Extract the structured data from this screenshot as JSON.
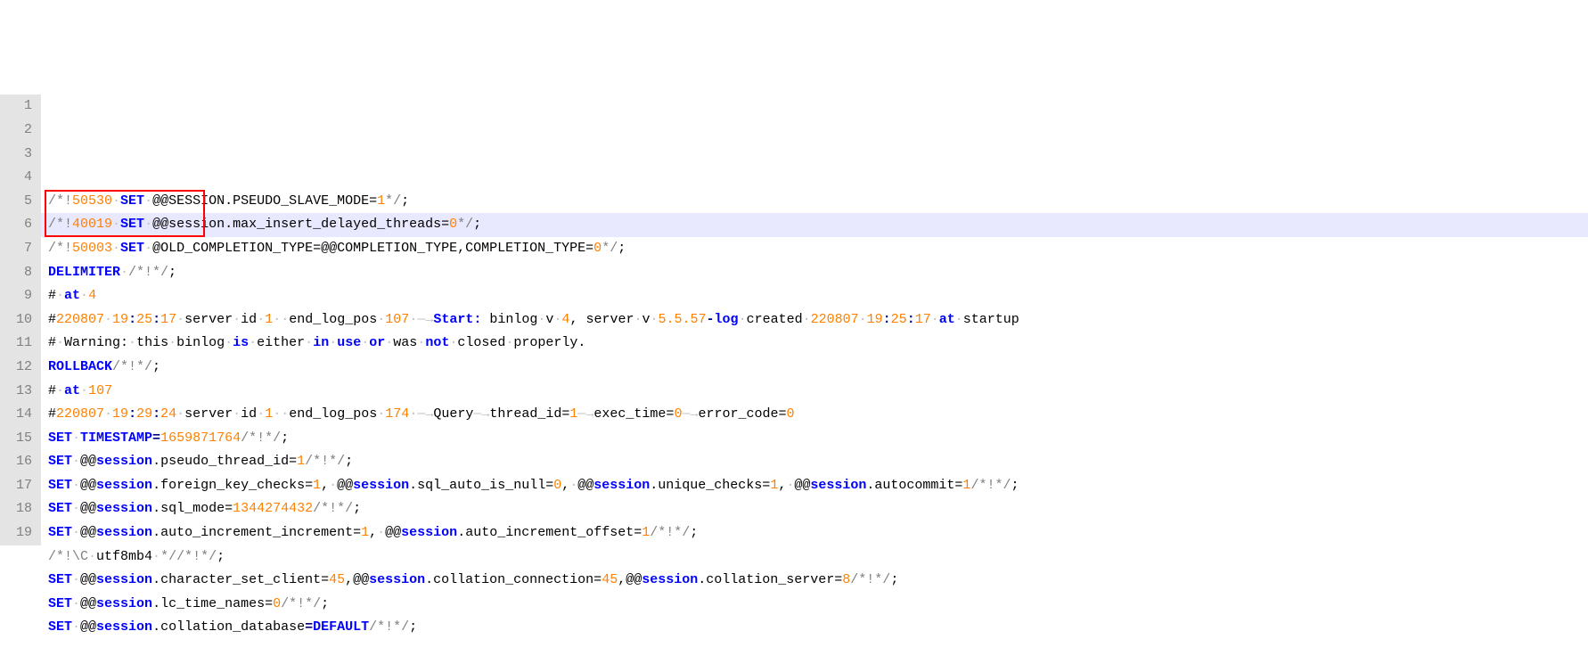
{
  "gutter": [
    "1",
    "2",
    "3",
    "4",
    "5",
    "6",
    "7",
    "8",
    "9",
    "10",
    "11",
    "12",
    "13",
    "14",
    "15",
    "16",
    "17",
    "18",
    "19"
  ],
  "highlight_row_index": 5,
  "red_box": {
    "top_line": 4,
    "left_ch": 0,
    "width_ch": 20,
    "height_lines": 2
  },
  "lines": [
    [
      {
        "t": "/*!",
        "c": "tk-str"
      },
      {
        "t": "50530",
        "c": "tk-num"
      },
      {
        "t": "·",
        "c": "ws-dot"
      },
      {
        "t": "SET",
        "c": "tk-kw"
      },
      {
        "t": "·",
        "c": "ws-dot"
      },
      {
        "t": "@@SESSION.PSEUDO_SLAVE_MODE=",
        "c": "tk-def"
      },
      {
        "t": "1",
        "c": "tk-num"
      },
      {
        "t": "*/",
        "c": "tk-str"
      },
      {
        "t": ";",
        "c": "tk-def"
      }
    ],
    [
      {
        "t": "/*!",
        "c": "tk-str"
      },
      {
        "t": "40019",
        "c": "tk-num"
      },
      {
        "t": "·",
        "c": "ws-dot"
      },
      {
        "t": "SET",
        "c": "tk-kw"
      },
      {
        "t": "·",
        "c": "ws-dot"
      },
      {
        "t": "@@session.max_insert_delayed_threads=",
        "c": "tk-def"
      },
      {
        "t": "0",
        "c": "tk-num"
      },
      {
        "t": "*/",
        "c": "tk-str"
      },
      {
        "t": ";",
        "c": "tk-def"
      }
    ],
    [
      {
        "t": "/*!",
        "c": "tk-str"
      },
      {
        "t": "50003",
        "c": "tk-num"
      },
      {
        "t": "·",
        "c": "ws-dot"
      },
      {
        "t": "SET",
        "c": "tk-kw"
      },
      {
        "t": "·",
        "c": "ws-dot"
      },
      {
        "t": "@OLD_COMPLETION_TYPE=@@COMPLETION_TYPE,COMPLETION_TYPE=",
        "c": "tk-def"
      },
      {
        "t": "0",
        "c": "tk-num"
      },
      {
        "t": "*/",
        "c": "tk-str"
      },
      {
        "t": ";",
        "c": "tk-def"
      }
    ],
    [
      {
        "t": "DELIMITER",
        "c": "tk-kw"
      },
      {
        "t": "·",
        "c": "ws-dot"
      },
      {
        "t": "/*!*/",
        "c": "tk-str"
      },
      {
        "t": ";",
        "c": "tk-def"
      }
    ],
    [
      {
        "t": "#",
        "c": "tk-def"
      },
      {
        "t": "·",
        "c": "ws-dot"
      },
      {
        "t": "at",
        "c": "tk-kw"
      },
      {
        "t": "·",
        "c": "ws-dot"
      },
      {
        "t": "4",
        "c": "tk-num"
      }
    ],
    [
      {
        "t": "#",
        "c": "tk-def"
      },
      {
        "t": "220807",
        "c": "tk-num"
      },
      {
        "t": "·",
        "c": "ws-dot"
      },
      {
        "t": "19",
        "c": "tk-num"
      },
      {
        "t": ":",
        "c": "tk-op"
      },
      {
        "t": "25",
        "c": "tk-num"
      },
      {
        "t": ":",
        "c": "tk-op"
      },
      {
        "t": "17",
        "c": "tk-num"
      },
      {
        "t": "·",
        "c": "ws-dot"
      },
      {
        "t": "server",
        "c": "tk-def"
      },
      {
        "t": "·",
        "c": "ws-dot"
      },
      {
        "t": "id",
        "c": "tk-def"
      },
      {
        "t": "·",
        "c": "ws-dot"
      },
      {
        "t": "1",
        "c": "tk-num"
      },
      {
        "t": "·",
        "c": "ws-dot"
      },
      {
        "t": "·",
        "c": "ws-dot"
      },
      {
        "t": "end_log_pos",
        "c": "tk-def"
      },
      {
        "t": "·",
        "c": "ws-dot"
      },
      {
        "t": "107",
        "c": "tk-num"
      },
      {
        "t": "·",
        "c": "ws-dot"
      },
      {
        "t": "→",
        "c": "ws-arr"
      },
      {
        "t": "Start:",
        "c": "tk-kw"
      },
      {
        "t": " binlog",
        "c": "tk-def"
      },
      {
        "t": "·",
        "c": "ws-dot"
      },
      {
        "t": "v",
        "c": "tk-def"
      },
      {
        "t": "·",
        "c": "ws-dot"
      },
      {
        "t": "4",
        "c": "tk-num"
      },
      {
        "t": ",",
        "c": "tk-def"
      },
      {
        "t": " server",
        "c": "tk-def"
      },
      {
        "t": "·",
        "c": "ws-dot"
      },
      {
        "t": "v",
        "c": "tk-def"
      },
      {
        "t": "·",
        "c": "ws-dot"
      },
      {
        "t": "5.5.57",
        "c": "tk-num"
      },
      {
        "t": "-",
        "c": "tk-op"
      },
      {
        "t": "log",
        "c": "tk-kw"
      },
      {
        "t": "·",
        "c": "ws-dot"
      },
      {
        "t": "created",
        "c": "tk-def"
      },
      {
        "t": "·",
        "c": "ws-dot"
      },
      {
        "t": "220807",
        "c": "tk-num"
      },
      {
        "t": "·",
        "c": "ws-dot"
      },
      {
        "t": "19",
        "c": "tk-num"
      },
      {
        "t": ":",
        "c": "tk-op"
      },
      {
        "t": "25",
        "c": "tk-num"
      },
      {
        "t": ":",
        "c": "tk-op"
      },
      {
        "t": "17",
        "c": "tk-num"
      },
      {
        "t": "·",
        "c": "ws-dot"
      },
      {
        "t": "at",
        "c": "tk-kw"
      },
      {
        "t": "·",
        "c": "ws-dot"
      },
      {
        "t": "startup",
        "c": "tk-def"
      }
    ],
    [
      {
        "t": "#",
        "c": "tk-def"
      },
      {
        "t": "·",
        "c": "ws-dot"
      },
      {
        "t": "Warning:",
        "c": "tk-def"
      },
      {
        "t": "·",
        "c": "ws-dot"
      },
      {
        "t": "this",
        "c": "tk-def"
      },
      {
        "t": "·",
        "c": "ws-dot"
      },
      {
        "t": "binlog",
        "c": "tk-def"
      },
      {
        "t": "·",
        "c": "ws-dot"
      },
      {
        "t": "is",
        "c": "tk-kw"
      },
      {
        "t": "·",
        "c": "ws-dot"
      },
      {
        "t": "either",
        "c": "tk-def"
      },
      {
        "t": "·",
        "c": "ws-dot"
      },
      {
        "t": "in",
        "c": "tk-kw"
      },
      {
        "t": "·",
        "c": "ws-dot"
      },
      {
        "t": "use",
        "c": "tk-kw"
      },
      {
        "t": "·",
        "c": "ws-dot"
      },
      {
        "t": "or",
        "c": "tk-kw"
      },
      {
        "t": "·",
        "c": "ws-dot"
      },
      {
        "t": "was",
        "c": "tk-def"
      },
      {
        "t": "·",
        "c": "ws-dot"
      },
      {
        "t": "not",
        "c": "tk-kw"
      },
      {
        "t": "·",
        "c": "ws-dot"
      },
      {
        "t": "closed",
        "c": "tk-def"
      },
      {
        "t": "·",
        "c": "ws-dot"
      },
      {
        "t": "properly.",
        "c": "tk-def"
      }
    ],
    [
      {
        "t": "ROLLBACK",
        "c": "tk-kw"
      },
      {
        "t": "/*!*/",
        "c": "tk-str"
      },
      {
        "t": ";",
        "c": "tk-def"
      }
    ],
    [
      {
        "t": "#",
        "c": "tk-def"
      },
      {
        "t": "·",
        "c": "ws-dot"
      },
      {
        "t": "at",
        "c": "tk-kw"
      },
      {
        "t": "·",
        "c": "ws-dot"
      },
      {
        "t": "107",
        "c": "tk-num"
      }
    ],
    [
      {
        "t": "#",
        "c": "tk-def"
      },
      {
        "t": "220807",
        "c": "tk-num"
      },
      {
        "t": "·",
        "c": "ws-dot"
      },
      {
        "t": "19",
        "c": "tk-num"
      },
      {
        "t": ":",
        "c": "tk-op"
      },
      {
        "t": "29",
        "c": "tk-num"
      },
      {
        "t": ":",
        "c": "tk-op"
      },
      {
        "t": "24",
        "c": "tk-num"
      },
      {
        "t": "·",
        "c": "ws-dot"
      },
      {
        "t": "server",
        "c": "tk-def"
      },
      {
        "t": "·",
        "c": "ws-dot"
      },
      {
        "t": "id",
        "c": "tk-def"
      },
      {
        "t": "·",
        "c": "ws-dot"
      },
      {
        "t": "1",
        "c": "tk-num"
      },
      {
        "t": "·",
        "c": "ws-dot"
      },
      {
        "t": "·",
        "c": "ws-dot"
      },
      {
        "t": "end_log_pos",
        "c": "tk-def"
      },
      {
        "t": "·",
        "c": "ws-dot"
      },
      {
        "t": "174",
        "c": "tk-num"
      },
      {
        "t": "·",
        "c": "ws-dot"
      },
      {
        "t": "→",
        "c": "ws-arr"
      },
      {
        "t": "Query",
        "c": "tk-def"
      },
      {
        "t": "→",
        "c": "ws-arr"
      },
      {
        "t": "thread_id=",
        "c": "tk-def"
      },
      {
        "t": "1",
        "c": "tk-num"
      },
      {
        "t": "→",
        "c": "ws-arr"
      },
      {
        "t": "exec_time=",
        "c": "tk-def"
      },
      {
        "t": "0",
        "c": "tk-num"
      },
      {
        "t": "→",
        "c": "ws-arr"
      },
      {
        "t": "error_code=",
        "c": "tk-def"
      },
      {
        "t": "0",
        "c": "tk-num"
      }
    ],
    [
      {
        "t": "SET",
        "c": "tk-kw"
      },
      {
        "t": "·",
        "c": "ws-dot"
      },
      {
        "t": "TIMESTAMP",
        "c": "tk-kw"
      },
      {
        "t": "=",
        "c": "tk-op"
      },
      {
        "t": "1659871764",
        "c": "tk-num"
      },
      {
        "t": "/*!*/",
        "c": "tk-str"
      },
      {
        "t": ";",
        "c": "tk-def"
      }
    ],
    [
      {
        "t": "SET",
        "c": "tk-kw"
      },
      {
        "t": "·",
        "c": "ws-dot"
      },
      {
        "t": "@@",
        "c": "tk-def"
      },
      {
        "t": "session",
        "c": "tk-kw"
      },
      {
        "t": ".pseudo_thread_id=",
        "c": "tk-def"
      },
      {
        "t": "1",
        "c": "tk-num"
      },
      {
        "t": "/*!*/",
        "c": "tk-str"
      },
      {
        "t": ";",
        "c": "tk-def"
      }
    ],
    [
      {
        "t": "SET",
        "c": "tk-kw"
      },
      {
        "t": "·",
        "c": "ws-dot"
      },
      {
        "t": "@@",
        "c": "tk-def"
      },
      {
        "t": "session",
        "c": "tk-kw"
      },
      {
        "t": ".foreign_key_checks=",
        "c": "tk-def"
      },
      {
        "t": "1",
        "c": "tk-num"
      },
      {
        "t": ",",
        "c": "tk-def"
      },
      {
        "t": "·",
        "c": "ws-dot"
      },
      {
        "t": "@@",
        "c": "tk-def"
      },
      {
        "t": "session",
        "c": "tk-kw"
      },
      {
        "t": ".sql_auto_is_null=",
        "c": "tk-def"
      },
      {
        "t": "0",
        "c": "tk-num"
      },
      {
        "t": ",",
        "c": "tk-def"
      },
      {
        "t": "·",
        "c": "ws-dot"
      },
      {
        "t": "@@",
        "c": "tk-def"
      },
      {
        "t": "session",
        "c": "tk-kw"
      },
      {
        "t": ".unique_checks=",
        "c": "tk-def"
      },
      {
        "t": "1",
        "c": "tk-num"
      },
      {
        "t": ",",
        "c": "tk-def"
      },
      {
        "t": "·",
        "c": "ws-dot"
      },
      {
        "t": "@@",
        "c": "tk-def"
      },
      {
        "t": "session",
        "c": "tk-kw"
      },
      {
        "t": ".autocommit=",
        "c": "tk-def"
      },
      {
        "t": "1",
        "c": "tk-num"
      },
      {
        "t": "/*!*/",
        "c": "tk-str"
      },
      {
        "t": ";",
        "c": "tk-def"
      }
    ],
    [
      {
        "t": "SET",
        "c": "tk-kw"
      },
      {
        "t": "·",
        "c": "ws-dot"
      },
      {
        "t": "@@",
        "c": "tk-def"
      },
      {
        "t": "session",
        "c": "tk-kw"
      },
      {
        "t": ".sql_mode=",
        "c": "tk-def"
      },
      {
        "t": "1344274432",
        "c": "tk-num"
      },
      {
        "t": "/*!*/",
        "c": "tk-str"
      },
      {
        "t": ";",
        "c": "tk-def"
      }
    ],
    [
      {
        "t": "SET",
        "c": "tk-kw"
      },
      {
        "t": "·",
        "c": "ws-dot"
      },
      {
        "t": "@@",
        "c": "tk-def"
      },
      {
        "t": "session",
        "c": "tk-kw"
      },
      {
        "t": ".auto_increment_increment=",
        "c": "tk-def"
      },
      {
        "t": "1",
        "c": "tk-num"
      },
      {
        "t": ",",
        "c": "tk-def"
      },
      {
        "t": "·",
        "c": "ws-dot"
      },
      {
        "t": "@@",
        "c": "tk-def"
      },
      {
        "t": "session",
        "c": "tk-kw"
      },
      {
        "t": ".auto_increment_offset=",
        "c": "tk-def"
      },
      {
        "t": "1",
        "c": "tk-num"
      },
      {
        "t": "/*!*/",
        "c": "tk-str"
      },
      {
        "t": ";",
        "c": "tk-def"
      }
    ],
    [
      {
        "t": "/*!\\C",
        "c": "tk-str"
      },
      {
        "t": "·",
        "c": "ws-dot"
      },
      {
        "t": "utf8mb4",
        "c": "tk-def"
      },
      {
        "t": "·",
        "c": "ws-dot"
      },
      {
        "t": "*/",
        "c": "tk-str"
      },
      {
        "t": "/*!*/",
        "c": "tk-str"
      },
      {
        "t": ";",
        "c": "tk-def"
      }
    ],
    [
      {
        "t": "SET",
        "c": "tk-kw"
      },
      {
        "t": "·",
        "c": "ws-dot"
      },
      {
        "t": "@@",
        "c": "tk-def"
      },
      {
        "t": "session",
        "c": "tk-kw"
      },
      {
        "t": ".character_set_client=",
        "c": "tk-def"
      },
      {
        "t": "45",
        "c": "tk-num"
      },
      {
        "t": ",@@",
        "c": "tk-def"
      },
      {
        "t": "session",
        "c": "tk-kw"
      },
      {
        "t": ".collation_connection=",
        "c": "tk-def"
      },
      {
        "t": "45",
        "c": "tk-num"
      },
      {
        "t": ",@@",
        "c": "tk-def"
      },
      {
        "t": "session",
        "c": "tk-kw"
      },
      {
        "t": ".collation_server=",
        "c": "tk-def"
      },
      {
        "t": "8",
        "c": "tk-num"
      },
      {
        "t": "/*!*/",
        "c": "tk-str"
      },
      {
        "t": ";",
        "c": "tk-def"
      }
    ],
    [
      {
        "t": "SET",
        "c": "tk-kw"
      },
      {
        "t": "·",
        "c": "ws-dot"
      },
      {
        "t": "@@",
        "c": "tk-def"
      },
      {
        "t": "session",
        "c": "tk-kw"
      },
      {
        "t": ".lc_time_names=",
        "c": "tk-def"
      },
      {
        "t": "0",
        "c": "tk-num"
      },
      {
        "t": "/*!*/",
        "c": "tk-str"
      },
      {
        "t": ";",
        "c": "tk-def"
      }
    ],
    [
      {
        "t": "SET",
        "c": "tk-kw"
      },
      {
        "t": "·",
        "c": "ws-dot"
      },
      {
        "t": "@@",
        "c": "tk-def"
      },
      {
        "t": "session",
        "c": "tk-kw"
      },
      {
        "t": ".collation_database",
        "c": "tk-def"
      },
      {
        "t": "=",
        "c": "tk-op"
      },
      {
        "t": "DEFAULT",
        "c": "tk-kw"
      },
      {
        "t": "/*!*/",
        "c": "tk-str"
      },
      {
        "t": ";",
        "c": "tk-def"
      }
    ]
  ]
}
